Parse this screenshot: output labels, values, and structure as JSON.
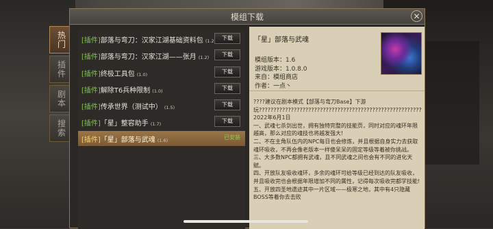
{
  "dialog": {
    "title": "模组下载",
    "close_icon": "close-icon"
  },
  "side_tabs": [
    {
      "label": "热门",
      "active": true
    },
    {
      "label": "插件",
      "active": false
    },
    {
      "label": "剧本",
      "active": false
    },
    {
      "label": "搜索",
      "active": false
    }
  ],
  "mods": [
    {
      "tag": "[插件]",
      "name": "部落与弯刀：汉家江湖基础资料包",
      "version": "(1.2)",
      "action": "下载"
    },
    {
      "tag": "[插件]",
      "name": "部落与弯刀：汉家江湖——张月",
      "version": "(1.2)",
      "action": "下载"
    },
    {
      "tag": "[插件]",
      "name": "终极工具包",
      "version": "(1.0)",
      "action": "下载"
    },
    {
      "tag": "[插件]",
      "name": "解除T6兵种限制",
      "version": "(1.0)",
      "action": "下载"
    },
    {
      "tag": "[插件]",
      "name": "传承世界（测试中）",
      "version": "(1.5)",
      "action": "下载"
    },
    {
      "tag": "[插件]",
      "name": "「星」整容助手",
      "version": "(1.7)",
      "action": "下载"
    },
    {
      "tag": "[插件]",
      "name": "「星」部落与武魂",
      "version": "(1.6)",
      "action": "已安装",
      "selected": true
    }
  ],
  "detail": {
    "title": "「星」部落与武魂",
    "mod_version": "模组版本：1.6",
    "game_version": "游戏版本：1.0.8.0",
    "source": "来自：模组商店",
    "author": "作者：一点丶",
    "description": [
      "????建议在剧本模式【部落与弯刀Base】下游玩????????????????????????????????????????????????????????",
      "2022年6月1日",
      "一、武魂七杀剑出世，拥有独特完整的技能页，同时对应的魂环年限越高，那么对应的魂技也将越发强大!",
      "二、不在主角队伍内的NPC每日也会修炼，并且根据自身实力去获取魂环吸收，不再会像老版本一样傻呆呆的固定等级等着被你挑战。",
      "三、大多数NPC都拥有武魂，且不同武魂之间也会有不同的进化天赋。",
      "四、开放队友吸收魂环，多余的魂环可给等级已经到达的队友吸收，并且吸收完也会根据年限增加不同的属性，记得每次吸收完都学技能!",
      "五、开放四圣地遗迹其中一片区域——极寒之地，其中有4只隐藏BOSS等着你去击败"
    ]
  }
}
